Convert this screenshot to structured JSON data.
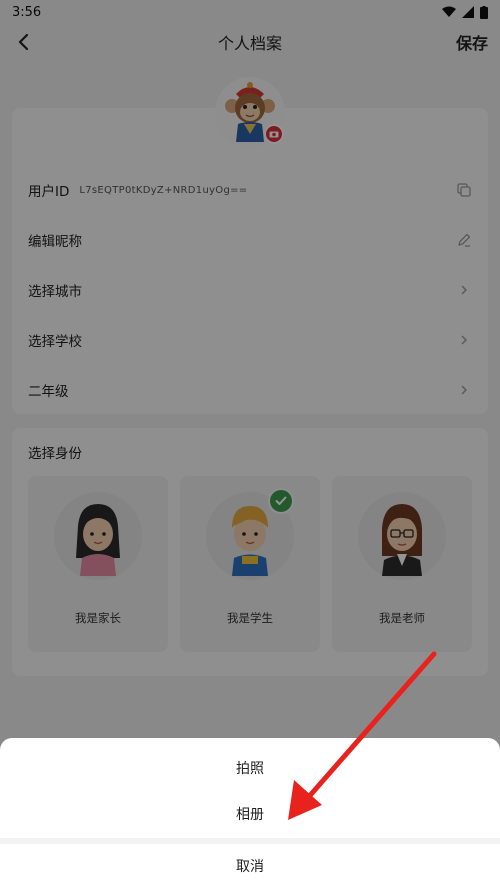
{
  "status": {
    "time": "3:56"
  },
  "header": {
    "title": "个人档案",
    "save_label": "保存"
  },
  "profile": {
    "user_id_label": "用户ID",
    "user_id_value": "L7sEQTP0tKDyZ+NRD1uyOg==",
    "nickname_label": "编辑昵称",
    "city_label": "选择城市",
    "school_label": "选择学校",
    "grade_label": "二年级"
  },
  "identity": {
    "title": "选择身份",
    "roles": [
      {
        "label": "我是家长",
        "selected": false
      },
      {
        "label": "我是学生",
        "selected": true
      },
      {
        "label": "我是老师",
        "selected": false
      }
    ]
  },
  "sheet": {
    "photo_label": "拍照",
    "album_label": "相册",
    "cancel_label": "取消"
  },
  "colors": {
    "arrow": "#e8221d",
    "check": "#3d9a4e",
    "camera_badge": "#d9303a"
  }
}
